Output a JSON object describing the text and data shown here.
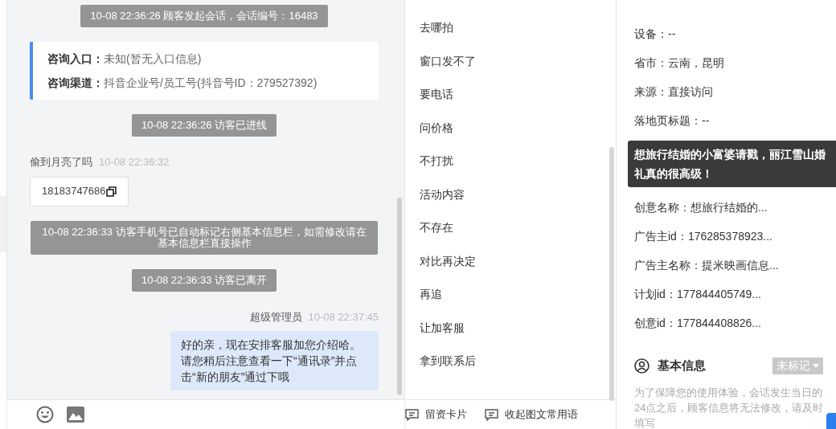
{
  "chat": {
    "messages": [
      {
        "kind": "system",
        "text": "10-08 22:36:26 顾客发起会话，会话编号：16483"
      },
      {
        "kind": "info",
        "lines": [
          {
            "label": "咨询入口：",
            "value": "未知(暂无入口信息)"
          },
          {
            "label": "咨询渠道：",
            "value": "抖音企业号/员工号(抖音号ID：279527392)"
          }
        ]
      },
      {
        "kind": "system",
        "text": "10-08 22:36:26 访客已进线"
      },
      {
        "kind": "visitor",
        "sender": "偷到月亮了吗",
        "time": "10-08 22:36:32",
        "text": "18183747686"
      },
      {
        "kind": "system",
        "text": "10-08 22:36:33 访客手机号已自动标记右侧基本信息栏，如需修改请在基本信息栏直接操作"
      },
      {
        "kind": "system",
        "text": "10-08 22:36:33 访客已离开"
      },
      {
        "kind": "agent",
        "sender": "超级管理员",
        "time": "10-08 22:37:45",
        "text": "好的亲，现在安排客服加您介绍哈。请您稍后注意查看一下“通讯录”并点击“新的朋友”通过下哦"
      }
    ]
  },
  "phrases": {
    "items": [
      "去哪拍",
      "窗口发不了",
      "要电话",
      "问价格",
      "不打扰",
      "活动内容",
      "不存在",
      "对比再决定",
      "再追",
      "让加客服",
      "拿到联系后"
    ],
    "actions": [
      "留资卡片",
      "收起图文常用语"
    ]
  },
  "visit_info": {
    "fields": [
      {
        "kind": "field",
        "text": "设备：--"
      },
      {
        "kind": "field",
        "text": "省市：云南，昆明"
      },
      {
        "kind": "field",
        "text": "来源：直接访问"
      },
      {
        "kind": "field",
        "text": "落地页标题：--"
      },
      {
        "kind": "tooltip",
        "text": "想旅行结婚的小富婆请戳，丽江雪山婚礼真的很高级！"
      },
      {
        "kind": "field",
        "text": "创意名称：想旅行结婚的..."
      },
      {
        "kind": "field",
        "text": "广告主id：176285378923..."
      },
      {
        "kind": "field",
        "text": "广告主名称：提米映画信息..."
      },
      {
        "kind": "field",
        "text": "计划id：177844405749..."
      },
      {
        "kind": "field",
        "text": "创意id：177844408826..."
      }
    ]
  },
  "basic_info": {
    "title": "基本信息",
    "tag": "未标记",
    "notice": "为了保障您的使用体验，会话发生当日的24点之后，顾客信息将无法修改，请及时填写"
  }
}
